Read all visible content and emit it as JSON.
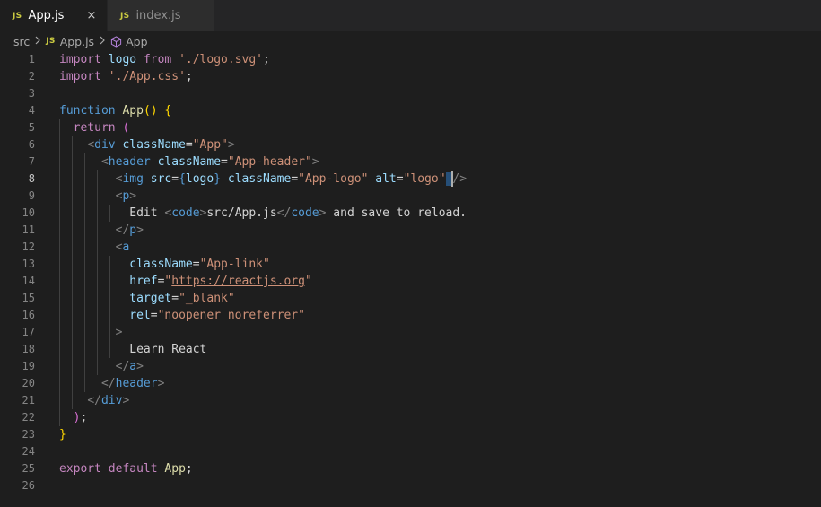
{
  "tabs": [
    {
      "badge": "JS",
      "label": "App.js",
      "close": "×",
      "active": true
    },
    {
      "badge": "JS",
      "label": "index.js",
      "active": false
    }
  ],
  "breadcrumb": {
    "folder": "src",
    "file_badge": "JS",
    "file": "App.js",
    "symbol": "App"
  },
  "editor": {
    "current_line": "8",
    "line_numbers": [
      "1",
      "2",
      "3",
      "4",
      "5",
      "6",
      "7",
      "8",
      "9",
      "10",
      "11",
      "12",
      "13",
      "14",
      "15",
      "16",
      "17",
      "18",
      "19",
      "20",
      "21",
      "22",
      "23",
      "24",
      "25",
      "26"
    ],
    "tokens": {
      "l1": [
        "import",
        "logo",
        "from",
        "'./logo.svg'",
        ";"
      ],
      "l2": [
        "import",
        "'./App.css'",
        ";"
      ],
      "l4": [
        "function",
        "App",
        "() {"
      ],
      "l5": [
        "return",
        "("
      ],
      "l6": [
        "<",
        "div",
        "className",
        "=",
        "\"App\"",
        ">"
      ],
      "l7": [
        "<",
        "header",
        "className",
        "=",
        "\"App-header\"",
        ">"
      ],
      "l8": [
        "<",
        "img",
        "src",
        "=",
        "{",
        "logo",
        "}",
        "className",
        "=",
        "\"App-logo\"",
        "alt",
        "=",
        "\"logo\"",
        " ",
        "/>"
      ],
      "l9": [
        "<",
        "p",
        ">"
      ],
      "l10": [
        "Edit ",
        "<",
        "code",
        ">",
        "src/App.js",
        "</",
        "code",
        ">",
        " and save to reload."
      ],
      "l11": [
        "</",
        "p",
        ">"
      ],
      "l12": [
        "<",
        "a"
      ],
      "l13": [
        "className",
        "=",
        "\"App-link\""
      ],
      "l14": [
        "href",
        "=",
        "\"",
        "https://reactjs.org",
        "\""
      ],
      "l15": [
        "target",
        "=",
        "\"_blank\""
      ],
      "l16": [
        "rel",
        "=",
        "\"noopener noreferrer\""
      ],
      "l17": [
        ">"
      ],
      "l18": [
        "Learn React"
      ],
      "l19": [
        "</",
        "a",
        ">"
      ],
      "l20": [
        "</",
        "header",
        ">"
      ],
      "l21": [
        "</",
        "div",
        ">"
      ],
      "l22": [
        ")",
        ";"
      ],
      "l23": [
        "}"
      ],
      "l25": [
        "export",
        "default",
        "App",
        ";"
      ]
    }
  },
  "colors": {
    "background": "#1e1e1e",
    "keyword_control": "#c586c0",
    "keyword_storage": "#569cd6",
    "function": "#dcdcaa",
    "string": "#ce9178",
    "variable": "#9cdcfe",
    "js_badge": "#cbcb41"
  },
  "icons": {
    "file_badge": "js-icon",
    "symbol": "cube-icon",
    "breadcrumb_sep": "chevron-right-icon",
    "close": "close-icon"
  }
}
